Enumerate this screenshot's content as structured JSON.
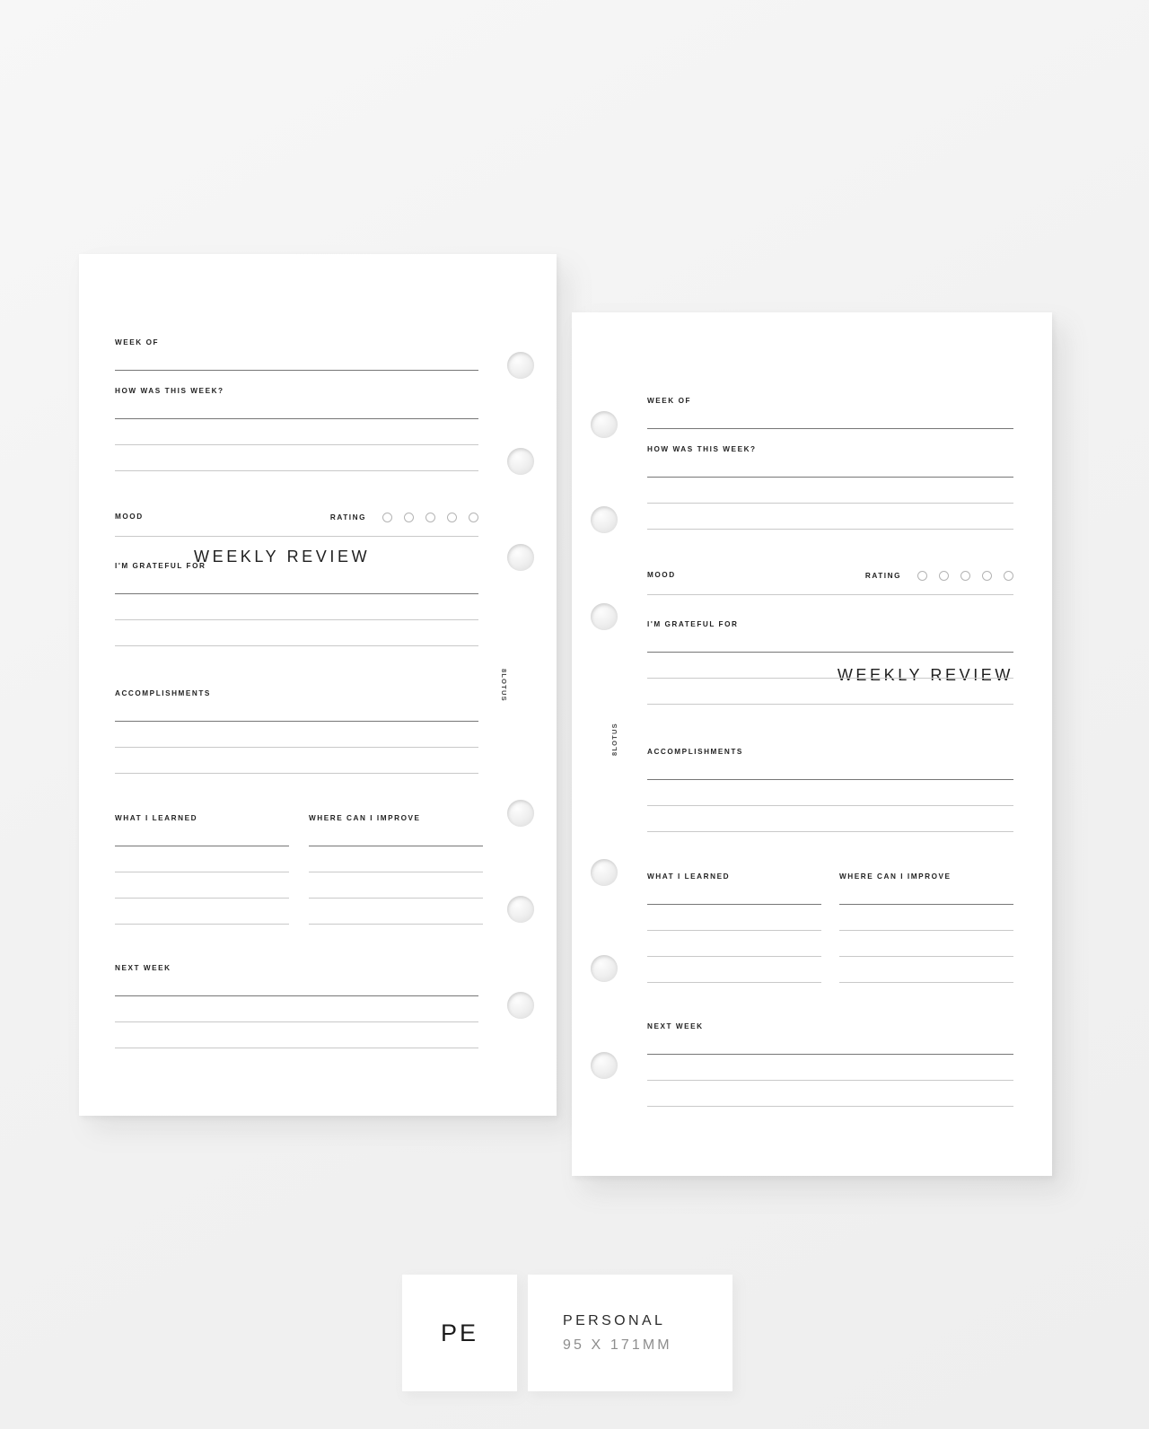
{
  "product": {
    "title": "WEEKLY REVIEW",
    "brand": "8LOTUS",
    "size_code": "PE",
    "size_name": "PERSONAL",
    "size_dims": "95 X 171MM"
  },
  "fields": {
    "week_of": "WEEK OF",
    "how_was_this_week": "HOW WAS THIS WEEK?",
    "mood": "MOOD",
    "rating": "RATING",
    "grateful_for": "I'M GRATEFUL FOR",
    "accomplishments": "ACCOMPLISHMENTS",
    "what_i_learned": "WHAT I LEARNED",
    "where_can_i_improve": "WHERE CAN I IMPROVE",
    "next_week": "NEXT WEEK"
  },
  "rating_dots": 5,
  "pages": [
    {
      "id": "left",
      "title_align": "left",
      "sections": [
        {
          "key": "week_of",
          "lines": 1
        },
        {
          "key": "how_was_this_week",
          "lines": 3
        },
        {
          "key": "mood",
          "lines": 1,
          "has_rating": true
        },
        {
          "key": "grateful_for",
          "lines": 3
        },
        {
          "key": "accomplishments",
          "lines": 3
        },
        {
          "key": "what_i_learned",
          "lines": 4,
          "paired_with": "where_can_i_improve"
        },
        {
          "key": "next_week",
          "lines": 3
        }
      ]
    },
    {
      "id": "right",
      "title_align": "right",
      "sections": [
        {
          "key": "week_of",
          "lines": 1
        },
        {
          "key": "how_was_this_week",
          "lines": 3
        },
        {
          "key": "mood",
          "lines": 1,
          "has_rating": true
        },
        {
          "key": "grateful_for",
          "lines": 3
        },
        {
          "key": "accomplishments",
          "lines": 3
        },
        {
          "key": "what_i_learned",
          "lines": 4,
          "paired_with": "where_can_i_improve"
        },
        {
          "key": "next_week",
          "lines": 3
        }
      ]
    }
  ]
}
